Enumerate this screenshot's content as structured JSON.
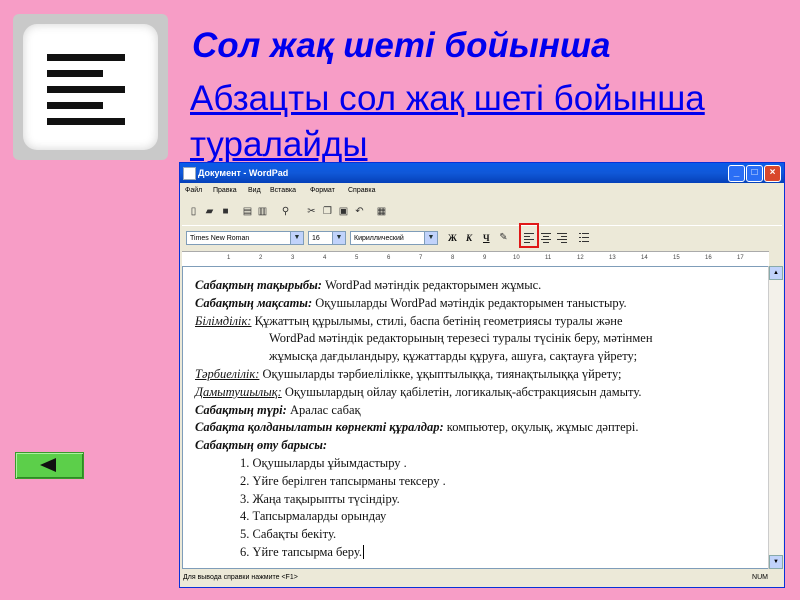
{
  "slide": {
    "title": "Сол жақ шеті бойынша",
    "description": "Абзацты сол жақ шеті бойынша туралайды"
  },
  "icons": {
    "big_icon": "align-left-icon",
    "back_button": "triangle-left-icon"
  },
  "colors": {
    "background": "#f79dc6",
    "title": "#0000ee",
    "back_button": "#5ccf4a",
    "highlight": "#e01818"
  },
  "window": {
    "title": "Документ - WordPad",
    "menu": [
      "Файл",
      "Правка",
      "Вид",
      "Вставка",
      "Формат",
      "Справка"
    ],
    "font_name": "Times New Roman",
    "font_size": "16",
    "script": "Кириллический",
    "format_buttons": [
      "Ж",
      "К",
      "Ч"
    ],
    "status": "Для вывода справки нажмите <F1>",
    "num": "NUM",
    "ruler": [
      "1",
      "2",
      "3",
      "4",
      "5",
      "6",
      "7",
      "8",
      "9",
      "10",
      "11",
      "12",
      "13",
      "14",
      "15",
      "16",
      "17"
    ]
  },
  "document": {
    "line1_label": "Сабақтың тақырыбы:",
    "line1_text": " WordPad мәтіндік редакторымен жұмыс.",
    "line2_label": "Сабақтың мақсаты:",
    "line2_text": " Оқушыларды WordPad мәтіндік редакторымен таныстыру.",
    "line3_label": "Білімділік:",
    "line3_text": "   Құжаттың құрылымы, стилі, баспа бетінің геометриясы туралы және",
    "line4_text": "WordPad мәтіндік редакторының терезесі туралы түсінік беру, мәтінмен",
    "line5_text": "жұмысқа дағдыландыру, құжаттарды құруға, ашуға, сақтауға үйрету;",
    "line6_label": "Тәрбиелілік:",
    "line6_text": " Оқушыларды тәрбиелілікке, ұқыптылыққа, тиянақтылыққа үйрету;",
    "line7_label": "Дамытушылық:",
    "line7_text": " Оқушылардың ойлау қабілетін, логикалық-абстракциясын дамыту.",
    "line8_label": "Сабақтың түрі:",
    "line8_text": " Аралас сабақ",
    "line9_label": "Сабақта қолданылатын көрнекті құралдар:",
    "line9_text": " компьютер, оқулық, жұмыс дәптері.",
    "line10_label": "Сабақтың өту барысы:",
    "steps": [
      "1.  Оқушыларды ұйымдастыру .",
      "2.    Үйге берілген тапсырманы тексеру .",
      "3.  Жаңа тақырыпты түсіндіру.",
      "4.    Тапсырмаларды орындау",
      "5.    Сабақты бекіту.",
      "6.    Үйге тапсырма беру."
    ]
  }
}
